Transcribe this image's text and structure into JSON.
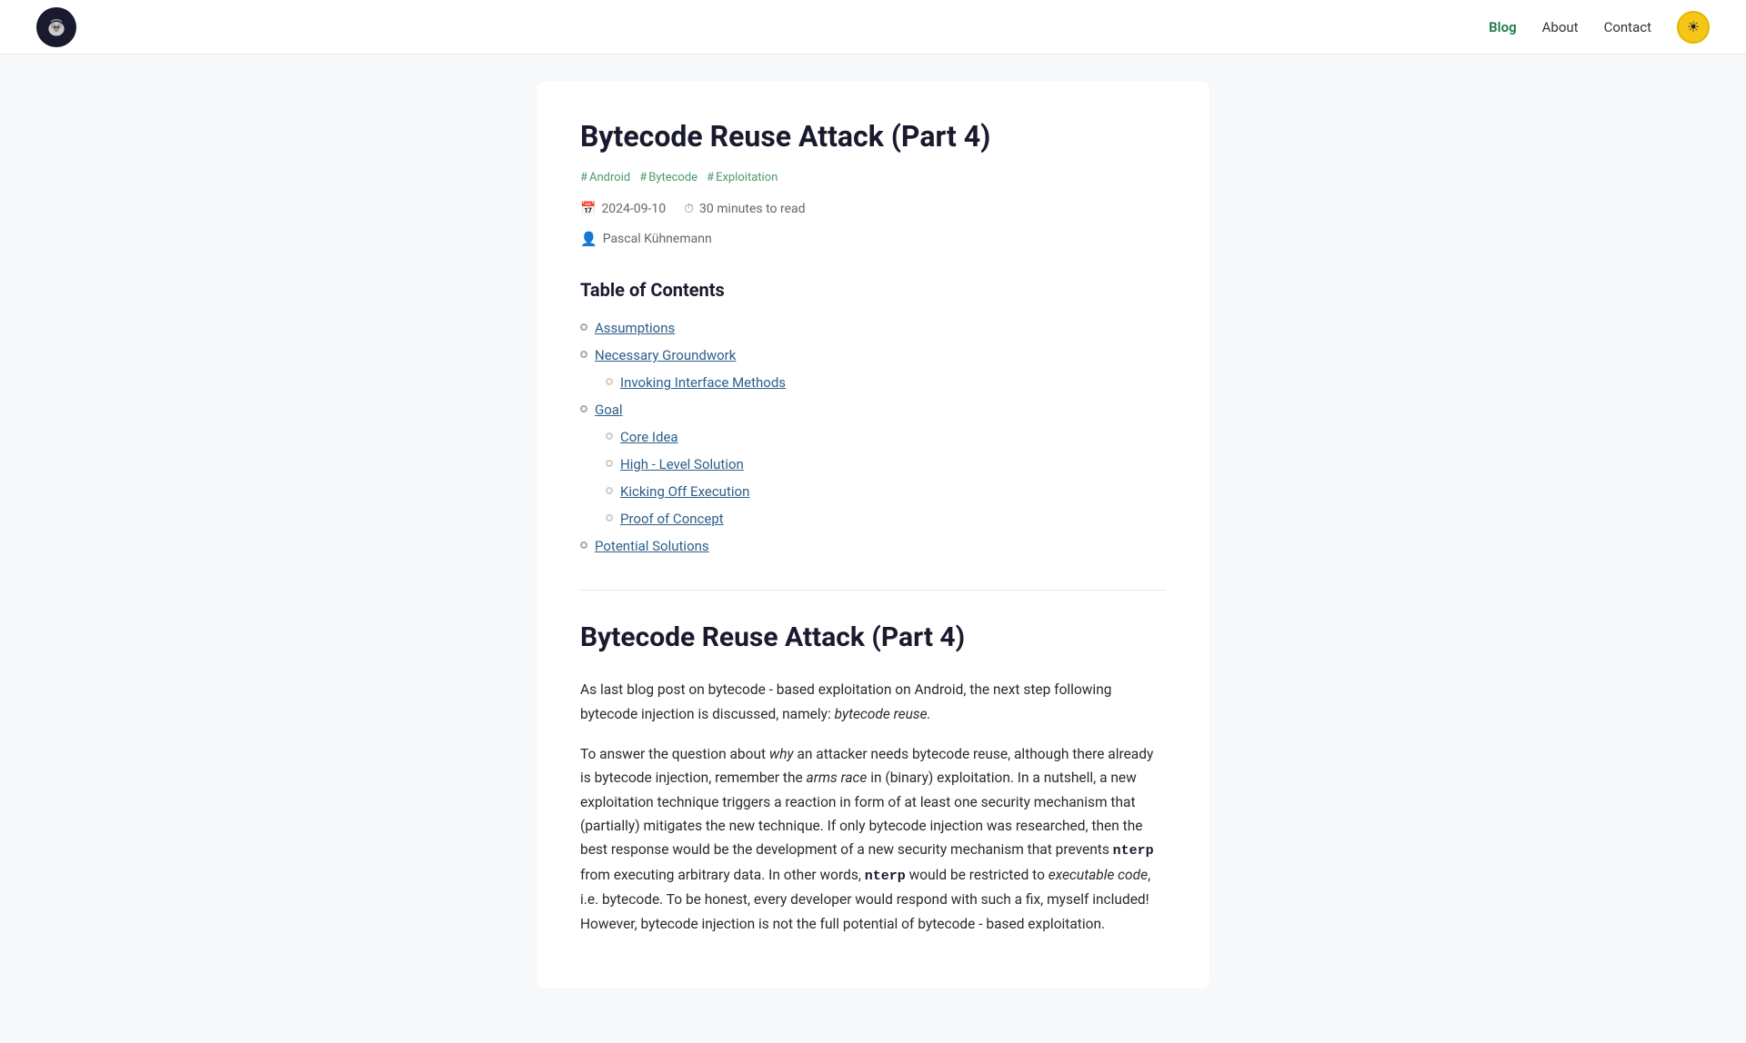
{
  "nav": {
    "logo_alt": "Site logo",
    "links": [
      {
        "label": "Blog",
        "active": true
      },
      {
        "label": "About",
        "active": false
      },
      {
        "label": "Contact",
        "active": false
      }
    ],
    "theme_toggle_icon": "☀"
  },
  "article": {
    "title": "Bytecode Reuse Attack (Part 4)",
    "tags": [
      "Android",
      "Bytecode",
      "Exploitation"
    ],
    "date": "2024-09-10",
    "read_time": "30 minutes to read",
    "author": "Pascal Kühnemann",
    "toc": {
      "heading": "Table of Contents",
      "items": [
        {
          "label": "Assumptions",
          "level": 1
        },
        {
          "label": "Necessary Groundwork",
          "level": 1
        },
        {
          "label": "Invoking Interface Methods",
          "level": 2
        },
        {
          "label": "Goal",
          "level": 1
        },
        {
          "label": "Core Idea",
          "level": 2
        },
        {
          "label": "High - Level Solution",
          "level": 2
        },
        {
          "label": "Kicking Off Execution",
          "level": 2
        },
        {
          "label": "Proof of Concept",
          "level": 2
        },
        {
          "label": "Potential Solutions",
          "level": 1
        }
      ]
    },
    "body_title": "Bytecode Reuse Attack (Part 4)",
    "paragraphs": [
      {
        "type": "text",
        "content": "As last blog post on bytecode - based exploitation on Android, the next step following bytecode injection is discussed, namely: bytecode reuse."
      },
      {
        "type": "text",
        "content": "To answer the question about why an attacker needs bytecode reuse, although there already is bytecode injection, remember the arms race in (binary) exploitation. In a nutshell, a new exploitation technique triggers a reaction in form of at least one security mechanism that (partially) mitigates the new technique. If only bytecode injection was researched, then the best response would be the development of a new security mechanism that prevents nterp from executing arbitrary data. In other words, nterp would be restricted to executable code, i.e. bytecode. To be honest, every developer would respond with such a fix, myself included! However, bytecode injection is not the full potential of bytecode - based exploitation."
      }
    ]
  }
}
